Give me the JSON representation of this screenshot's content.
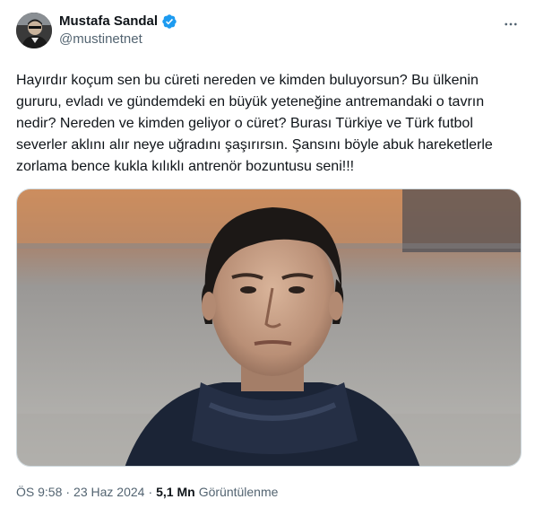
{
  "author": {
    "display_name": "Mustafa Sandal",
    "handle": "@mustinetnet",
    "verified": true,
    "verified_color": "#1d9bf0"
  },
  "tweet": {
    "text": "Hayırdır koçum sen bu cüreti nereden ve kimden buluyorsun? Bu ülkenin gururu, evladı ve gündemdeki en büyük yeteneğine antremandaki o tavrın nedir? Nereden ve kimden geliyor o cüret? Burası Türkiye ve Türk futbol severler aklını alır neye uğradını şaşırırsın. Şansını böyle abuk hareketlerle zorlama bence kukla kılıklı antrenör bozuntusu seni!!!"
  },
  "meta": {
    "time": "ÖS 9:58",
    "date": "23 Haz 2024",
    "views_count": "5,1 Mn",
    "views_label": "Görüntülenme",
    "separator": "·"
  },
  "icons": {
    "more": "more-dots-icon",
    "verified": "verified-badge-icon"
  }
}
